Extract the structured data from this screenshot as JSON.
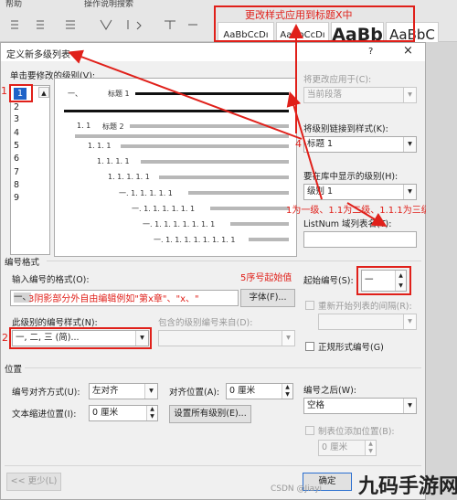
{
  "ribbon": {
    "menu_help": "帮助",
    "menu_tell": "操作说明搜索",
    "styles": [
      "AaBbCcDı",
      "AaBbCcDı",
      "AaBb",
      "AaBbC"
    ],
    "top_annotation": "更改样式应用到标题X中"
  },
  "dialog": {
    "title": "定义新多级列表",
    "help_icon": "?",
    "close_icon": "×",
    "level_label": "单击要修改的级别(V):",
    "levels": [
      "1",
      "2",
      "3",
      "4",
      "5",
      "6",
      "7",
      "8",
      "9"
    ],
    "selected_level": "1",
    "preview_lines": [
      "一、",
      "标题 1",
      "1. 1",
      "标题 2",
      "1. 1. 1",
      "1. 1. 1. 1",
      "1. 1. 1. 1. 1",
      "一. 1. 1. 1. 1. 1",
      "一. 1. 1. 1. 1. 1. 1",
      "一. 1. 1. 1. 1. 1. 1. 1",
      "一. 1. 1. 1. 1. 1. 1. 1. 1"
    ],
    "apply_to_label": "将更改应用于(C):",
    "apply_to_value": "当前段落",
    "link_style_label": "将级别链接到样式(K):",
    "link_style_value": "标题 1",
    "gallery_level_label": "要在库中显示的级别(H):",
    "gallery_level_value": "级别 1",
    "listnum_label": "ListNum 域列表名(T):",
    "listnum_value": "",
    "number_format_group": "编号格式",
    "enter_format_label": "输入编号的格式(O):",
    "enter_format_value": "一、",
    "font_button": "字体(F)...",
    "start_at_label": "起始编号(S):",
    "start_at_value": "一",
    "restart_label": "重新开始列表的间隔(R):",
    "number_style_label": "此级别的编号样式(N):",
    "number_style_value": "一, 二, 三 (简)...",
    "include_level_label": "包含的级别编号来自(D):",
    "legal_label": "正规形式编号(G)",
    "position_group": "位置",
    "alignment_label": "编号对齐方式(U):",
    "alignment_value": "左对齐",
    "aligned_at_label": "对齐位置(A):",
    "aligned_at_value": "0 厘米",
    "follow_label": "编号之后(W):",
    "follow_value": "空格",
    "indent_label": "文本缩进位置(I):",
    "indent_value": "0 厘米",
    "set_all_button": "设置所有级别(E)...",
    "tab_stop_label": "制表位添加位置(B):",
    "tab_stop_value": "0 厘米",
    "less_button": "<< 更少(L)",
    "ok_button": "确定"
  },
  "annotations": {
    "a1": "1",
    "a2": "2",
    "a3": "3阴影部分外自由编辑例如\"第x章\"、\"x、\"",
    "a4": "4",
    "a5": "5序号起始值",
    "levels_note": "1为一级、1.1为二级、1.1.1为三级"
  },
  "watermark": {
    "csdn": "CSDN @Jiayi",
    "site": "九码手游网"
  },
  "colors": {
    "annotation_red": "#e0201a",
    "selection_blue": "#1e63c8"
  }
}
